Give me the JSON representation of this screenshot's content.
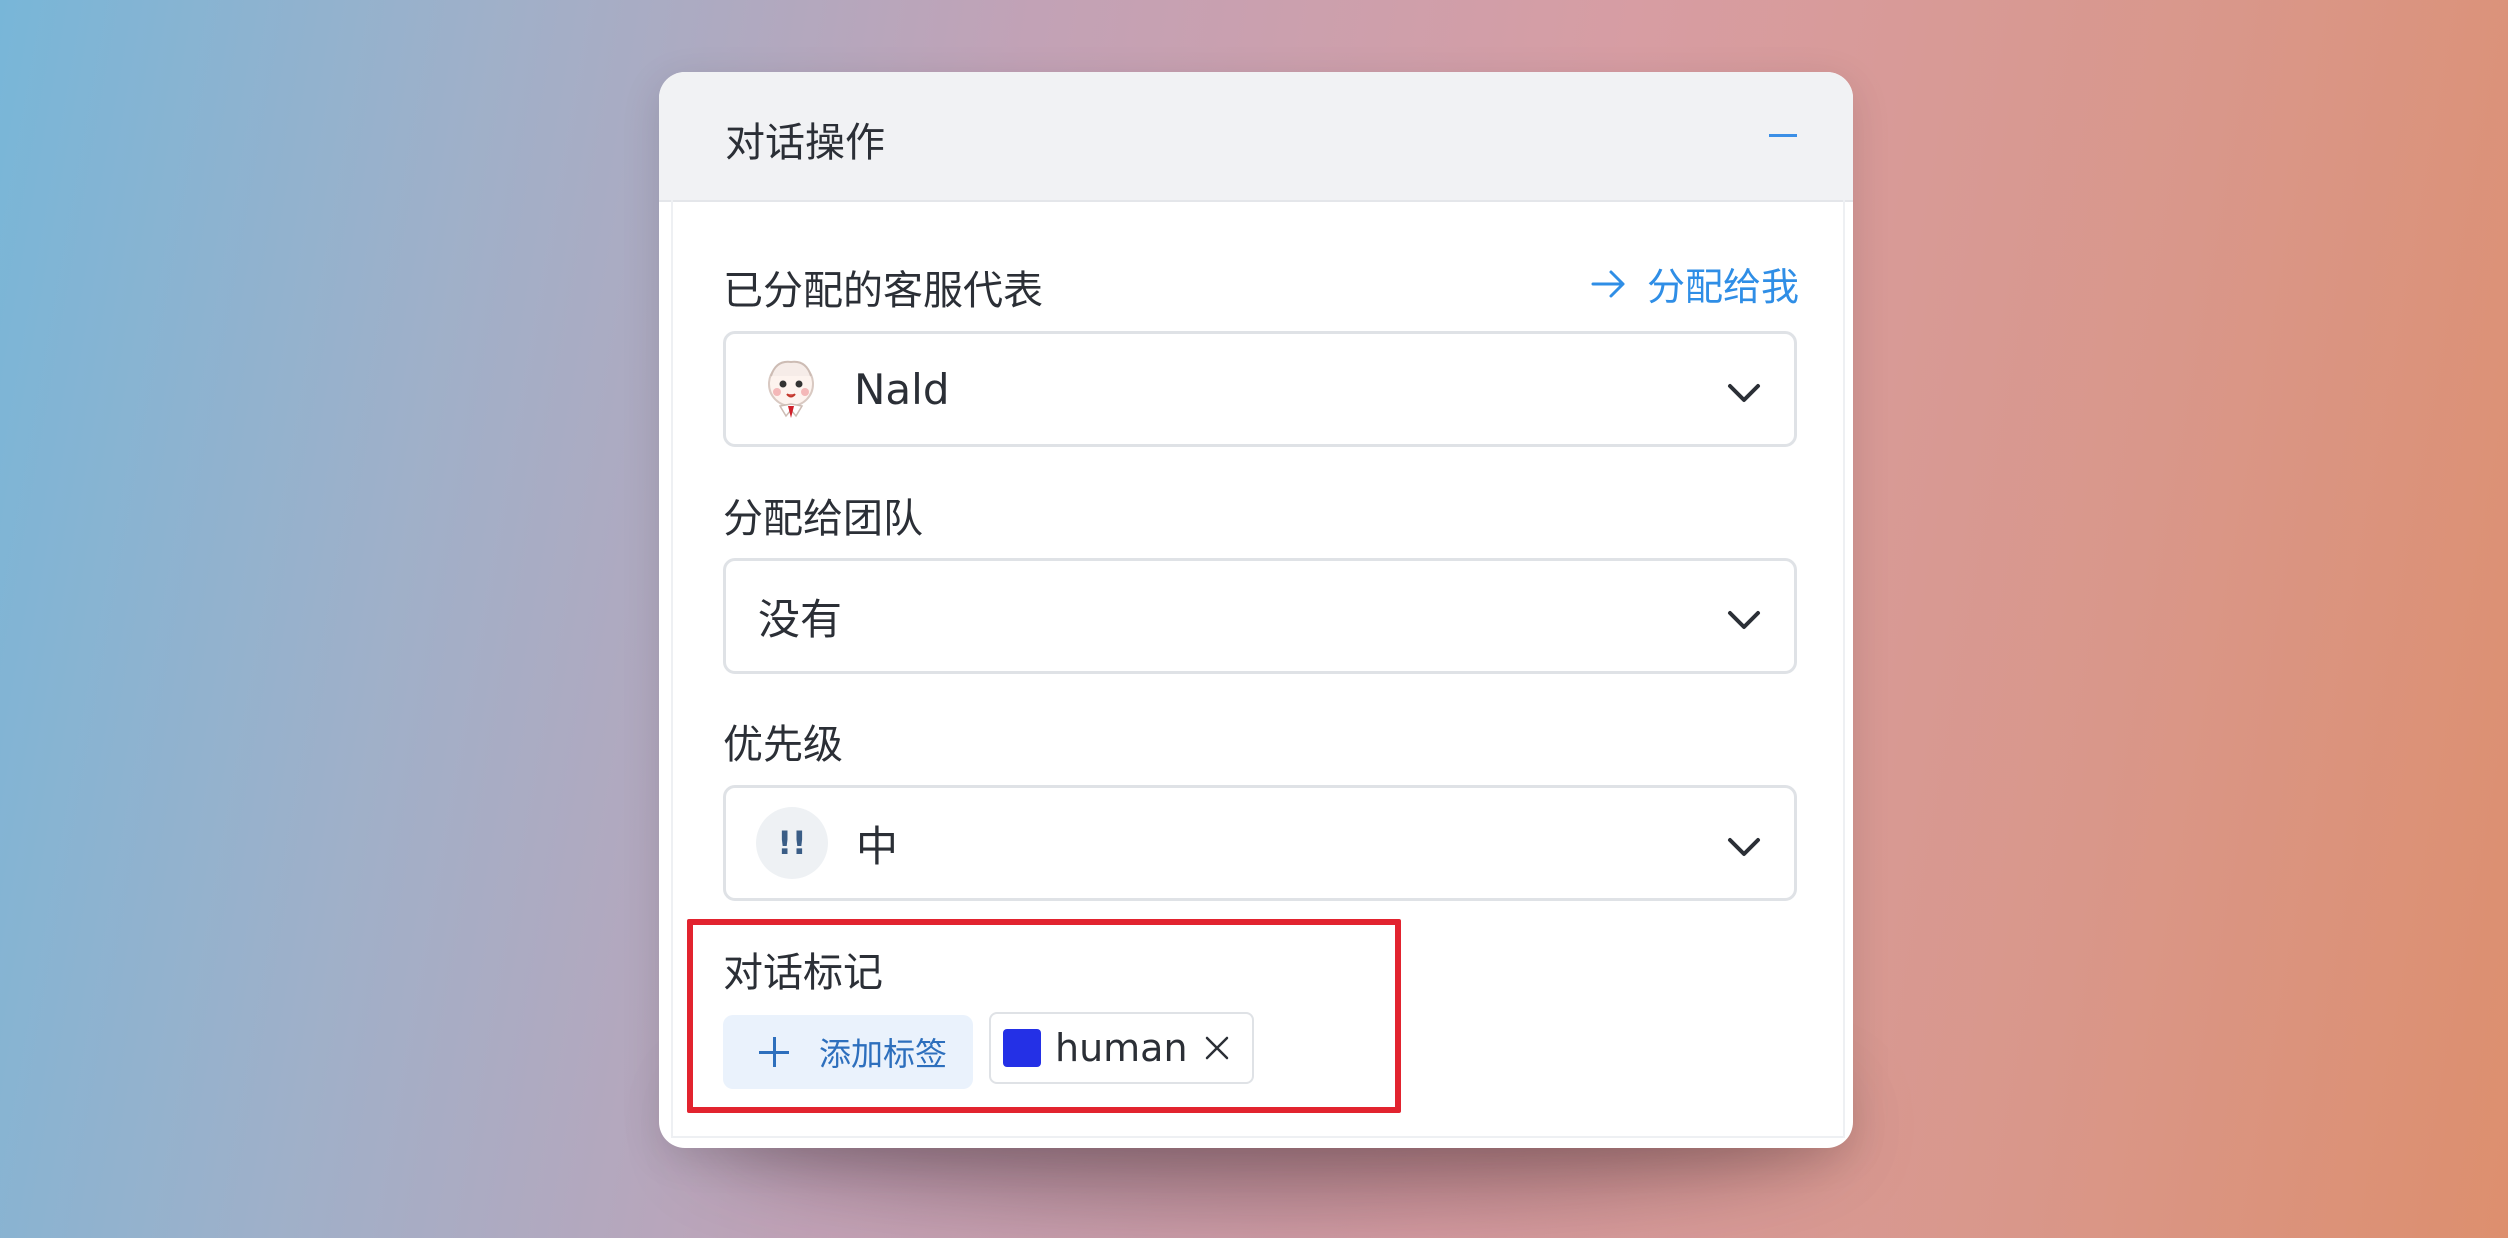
{
  "panel": {
    "title": "对话操作"
  },
  "assignee": {
    "label": "已分配的客服代表",
    "assign_to_me": "分配给我",
    "selected": "Nald"
  },
  "team": {
    "label": "分配给团队",
    "selected": "没有"
  },
  "priority": {
    "label": "优先级",
    "icon_text": "!!",
    "selected": "中"
  },
  "labels": {
    "label": "对话标记",
    "add_button": "添加标签",
    "tags": [
      {
        "name": "human",
        "color": "#2430e6"
      }
    ]
  },
  "colors": {
    "accent": "#2f8ee6",
    "highlight": "#e2232f"
  }
}
